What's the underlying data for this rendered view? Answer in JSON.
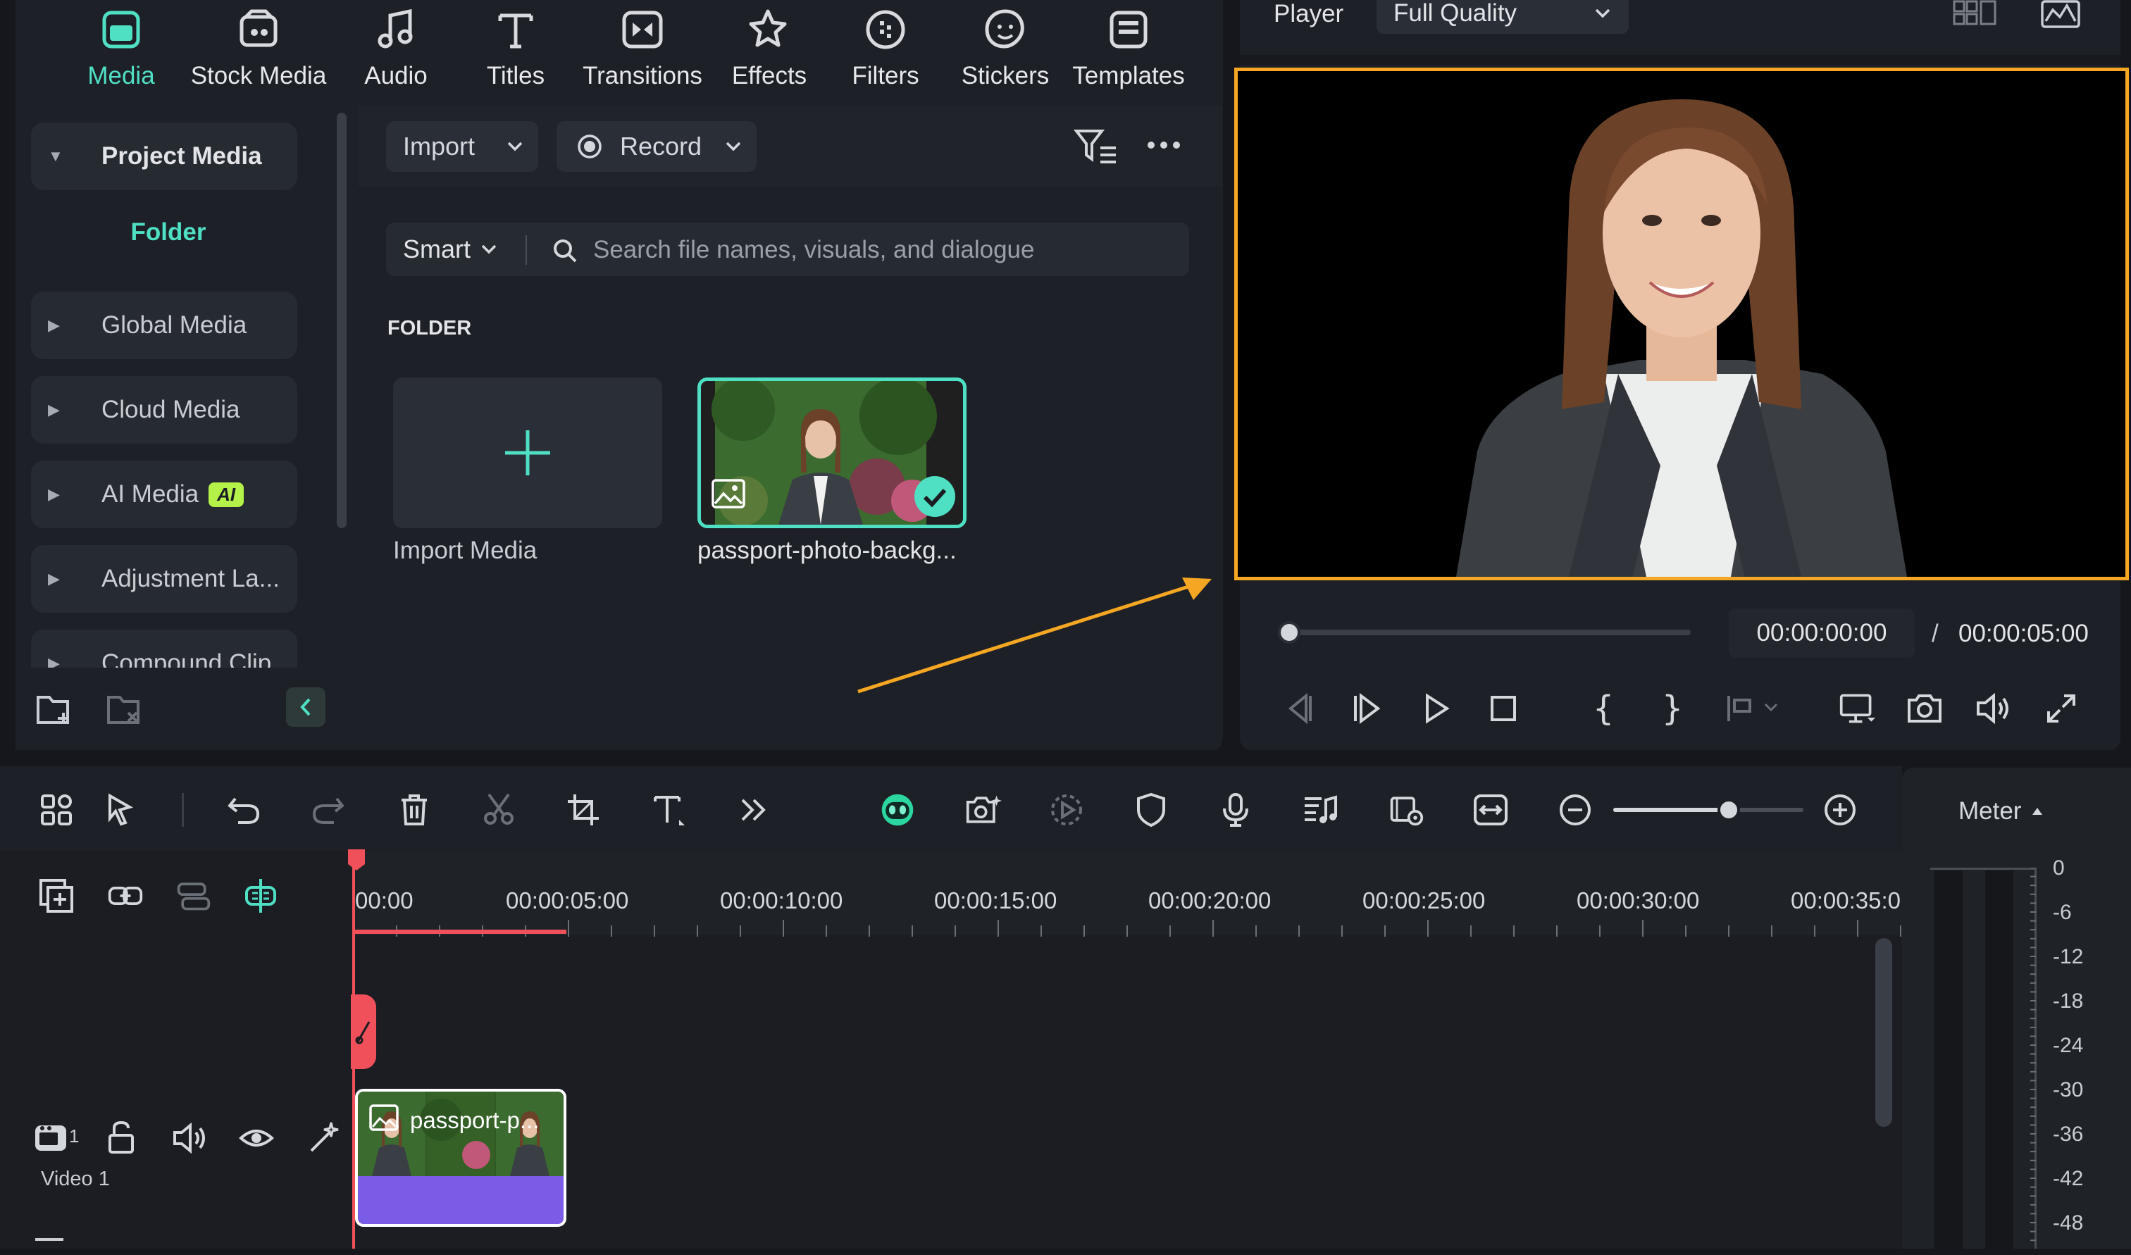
{
  "top_nav": {
    "items": [
      {
        "label": "Media",
        "icon": "media-icon",
        "active": true
      },
      {
        "label": "Stock Media",
        "icon": "stock-media-icon"
      },
      {
        "label": "Audio",
        "icon": "music-note-icon"
      },
      {
        "label": "Titles",
        "icon": "titles-t-icon"
      },
      {
        "label": "Transitions",
        "icon": "transitions-icon"
      },
      {
        "label": "Effects",
        "icon": "effects-star-icon"
      },
      {
        "label": "Filters",
        "icon": "filters-icon"
      },
      {
        "label": "Stickers",
        "icon": "stickers-icon"
      },
      {
        "label": "Templates",
        "icon": "templates-icon"
      }
    ]
  },
  "sidebar": {
    "items": [
      {
        "label": "Project Media"
      },
      {
        "label": "Folder"
      },
      {
        "label": "Global Media"
      },
      {
        "label": "Cloud Media"
      },
      {
        "label": "AI Media",
        "badge": "AI"
      },
      {
        "label": "Adjustment La..."
      },
      {
        "label": "Compound Clip"
      }
    ]
  },
  "media_toolbar": {
    "import_label": "Import",
    "record_label": "Record",
    "smart_label": "Smart",
    "search_placeholder": "Search file names, visuals, and dialogue"
  },
  "media_area": {
    "section_title": "FOLDER",
    "import_tile_label": "Import Media",
    "file_tile_label": "passport-photo-backg..."
  },
  "player": {
    "label": "Player",
    "quality": "Full Quality",
    "current_time": "00:00:00:00",
    "separator": "/",
    "total_time": "00:00:05:00",
    "progress": 0
  },
  "timeline": {
    "ruler_ticks": [
      "00:00",
      "00:00:05:00",
      "00:00:10:00",
      "00:00:15:00",
      "00:00:20:00",
      "00:00:25:00",
      "00:00:30:00",
      "00:00:35:0"
    ],
    "track_number": "1",
    "track_label": "Video 1",
    "clip_label": "passport-p...",
    "zoom_level": 0.6
  },
  "meter": {
    "title": "Meter",
    "scale": [
      "0",
      "-6",
      "-12",
      "-18",
      "-24",
      "-30",
      "-36",
      "-42",
      "-48"
    ]
  },
  "colors": {
    "accent": "#4fe0c4",
    "annotation": "#f5a623",
    "playhead": "#f0505a",
    "clip_audio": "#7a5ce6"
  }
}
